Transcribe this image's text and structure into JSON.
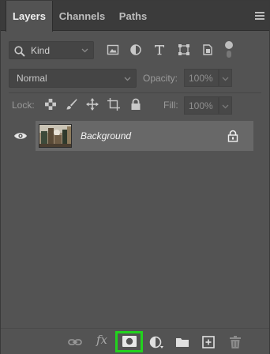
{
  "tabs": [
    {
      "label": "Layers",
      "active": true
    },
    {
      "label": "Channels",
      "active": false
    },
    {
      "label": "Paths",
      "active": false
    }
  ],
  "filter": {
    "kind_label": "Kind",
    "icons": [
      "pixel-filter-icon",
      "adjustment-filter-icon",
      "type-filter-icon",
      "shape-filter-icon",
      "smart-object-filter-icon",
      "filter-toggle-icon"
    ]
  },
  "blend": {
    "mode": "Normal",
    "opacity_label": "Opacity:",
    "opacity_value": "100%"
  },
  "lock": {
    "label": "Lock:",
    "fill_label": "Fill:",
    "fill_value": "100%",
    "icons": [
      "lock-transparent-icon",
      "lock-image-icon",
      "lock-position-icon",
      "lock-artboard-icon",
      "lock-all-icon"
    ]
  },
  "layers": [
    {
      "name": "Background",
      "visible": true,
      "locked": true
    }
  ],
  "bottom_toolbar": {
    "fx_label": "fx",
    "highlight_color": "#22d21e",
    "icons": [
      "link-layers-icon",
      "layer-style-icon",
      "add-mask-icon",
      "adjustment-layer-icon",
      "new-group-icon",
      "new-layer-icon",
      "delete-layer-icon"
    ]
  }
}
